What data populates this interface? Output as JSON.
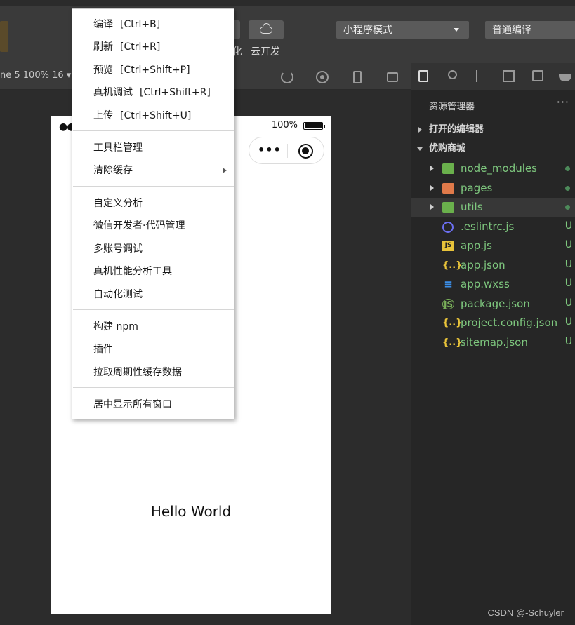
{
  "toolbar": {
    "cloud_label": "云开发",
    "partial_label": "化",
    "mode_select": "小程序模式",
    "compile_select": "普通编译"
  },
  "simulator": {
    "device_info": "ne 5 100% 16 ▾",
    "status_signal": "●●",
    "battery_text": "100%",
    "capsule_dots": "•••",
    "hello_text": "Hello World"
  },
  "explorer": {
    "title": "资源管理器",
    "more": "···",
    "open_editors": "打开的编辑器",
    "project": "优购商城",
    "files": [
      {
        "name": "node_modules",
        "icon": "folder-green-icon",
        "kind": "folder",
        "status": ""
      },
      {
        "name": "pages",
        "icon": "folder-orange-icon",
        "kind": "folder",
        "status": ""
      },
      {
        "name": "utils",
        "icon": "folder-green-icon",
        "kind": "folder",
        "status": ""
      },
      {
        "name": ".eslintrc.js",
        "icon": "eslint-icon",
        "kind": "file",
        "status": "U"
      },
      {
        "name": "app.js",
        "icon": "js-icon",
        "kind": "file",
        "status": "U"
      },
      {
        "name": "app.json",
        "icon": "json-icon",
        "kind": "file",
        "status": "U"
      },
      {
        "name": "app.wxss",
        "icon": "css-icon",
        "kind": "file",
        "status": "U"
      },
      {
        "name": "package.json",
        "icon": "nodejs-icon",
        "kind": "file",
        "status": "U"
      },
      {
        "name": "project.config.json",
        "icon": "json-icon",
        "kind": "file",
        "status": "U"
      },
      {
        "name": "sitemap.json",
        "icon": "json-icon",
        "kind": "file",
        "status": "U"
      }
    ]
  },
  "menu": {
    "items": [
      {
        "label": "编译",
        "shortcut": "[Ctrl+B]"
      },
      {
        "label": "刷新",
        "shortcut": "[Ctrl+R]"
      },
      {
        "label": "预览",
        "shortcut": "[Ctrl+Shift+P]"
      },
      {
        "label": "真机调试",
        "shortcut": "[Ctrl+Shift+R]"
      },
      {
        "label": "上传",
        "shortcut": "[Ctrl+Shift+U]"
      },
      {
        "label": "工具栏管理",
        "shortcut": ""
      },
      {
        "label": "清除缓存",
        "shortcut": ""
      },
      {
        "label": "自定义分析",
        "shortcut": ""
      },
      {
        "label": "微信开发者·代码管理",
        "shortcut": ""
      },
      {
        "label": "多账号调试",
        "shortcut": ""
      },
      {
        "label": "真机性能分析工具",
        "shortcut": ""
      },
      {
        "label": "自动化测试",
        "shortcut": ""
      },
      {
        "label": "构建 npm",
        "shortcut": ""
      },
      {
        "label": "插件",
        "shortcut": ""
      },
      {
        "label": "拉取周期性缓存数据",
        "shortcut": ""
      },
      {
        "label": "居中显示所有窗口",
        "shortcut": ""
      }
    ]
  },
  "watermark": "CSDN @-Schuyler",
  "colors": {
    "accent_green": "#7ec77e",
    "toolbar_bg": "#3a3a3a",
    "explorer_bg": "#262626"
  }
}
